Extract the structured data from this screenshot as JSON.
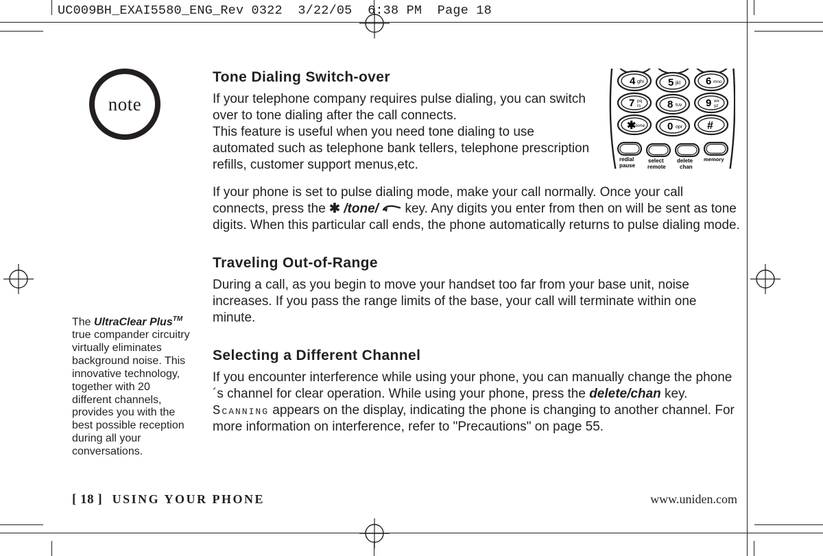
{
  "slug": "UC009BH_EXAI5580_ENG_Rev 0322  3/22/05  6:38 PM  Page 18",
  "note_badge": "note",
  "sidebar": {
    "brand": "UltraClear Plus",
    "tm": "TM",
    "prefix": "The ",
    "rest": " true compander circuitry virtually eliminates background noise. This innovative technology, together with 20 different channels, provides you with the best possible reception during all your conversations."
  },
  "sections": {
    "s1": {
      "title": "Tone Dialing Switch-over",
      "p1a": "If your telephone company requires pulse dialing, you can switch over to tone dialing after the call connects.",
      "p1b": "This feature is useful when you need tone dialing to use automated such as telephone bank tellers, telephone prescription refills, customer support menus,etc.",
      "p2a": "If your phone is set to pulse dialing mode, make your call normally. Once your call connects, press the ",
      "keylabel": "/tone/",
      "p2b": " key. Any digits you enter from then on will be sent as tone digits. When this particular call ends, the phone automatically returns to pulse dialing mode."
    },
    "s2": {
      "title": "Traveling Out-of-Range",
      "p": "During a call, as you begin to move your handset too far from your base unit, noise increases. If you pass the range limits of the base, your call will terminate within one minute."
    },
    "s3": {
      "title": "Selecting a Different Channel",
      "p_a": "If you encounter interference while using your phone, you can manually change the phone´s channel for clear operation. While using your phone, press the ",
      "key": "delete/chan",
      "p_b": " key. ",
      "lcd": "Scanning",
      "p_c": " appears on the display, indicating the phone is changing to another channel. For more information on interference, refer to \"Precautions\" on page 55."
    }
  },
  "footer": {
    "page": "[ 18 ]",
    "section": "USING YOUR PHONE",
    "url": "www.uniden.com"
  },
  "keypad": {
    "keys": [
      {
        "main": "4",
        "sub": "ghi"
      },
      {
        "main": "5",
        "sub": "jkl"
      },
      {
        "main": "6",
        "sub": "mno"
      },
      {
        "main": "7",
        "sub": "pq\nrs"
      },
      {
        "main": "8",
        "sub": "tuv"
      },
      {
        "main": "9",
        "sub": "wx\nyz"
      },
      {
        "main": "✱",
        "sub": "tone"
      },
      {
        "main": "0",
        "sub": "opr"
      },
      {
        "main": "#",
        "sub": ""
      }
    ],
    "soft": [
      {
        "l1": "redial",
        "l2": "pause"
      },
      {
        "l1": "select",
        "l2": "remote"
      },
      {
        "l1": "delete",
        "l2": "chan"
      },
      {
        "l1": "memory",
        "l2": ""
      }
    ]
  }
}
